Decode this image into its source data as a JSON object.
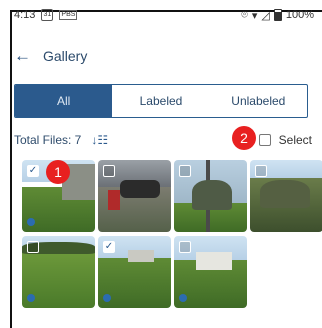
{
  "status": {
    "time": "4:13",
    "calendar": "31",
    "battery": "100%"
  },
  "appbar": {
    "back_icon": "arrow-left-icon",
    "title": "Gallery"
  },
  "tabs": [
    {
      "label": "All",
      "active": true
    },
    {
      "label": "Labeled",
      "active": false
    },
    {
      "label": "Unlabeled",
      "active": false
    }
  ],
  "files": {
    "total_label": "Total Files: 7",
    "select_label": "Select"
  },
  "annotations": {
    "badge_1": "1",
    "badge_2": "2"
  },
  "colors": {
    "primary": "#2b5a8d",
    "badge": "#e82020"
  },
  "thumbnails": [
    {
      "checked": true,
      "description": "house side yard with grass"
    },
    {
      "checked": false,
      "description": "red car in driveway"
    },
    {
      "checked": false,
      "description": "utility pole and tree"
    },
    {
      "checked": false,
      "description": "yard with shrubs"
    },
    {
      "checked": false,
      "description": "green lawn"
    },
    {
      "checked": true,
      "description": "lawn with houses"
    },
    {
      "checked": false,
      "description": "small white house"
    }
  ]
}
